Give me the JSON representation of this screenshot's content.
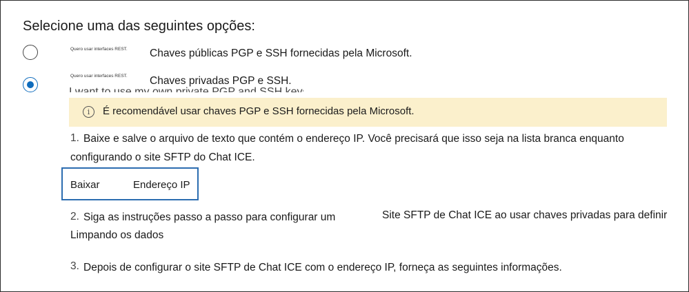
{
  "prompt": "Selecione uma das seguintes opções:",
  "options": [
    {
      "small_text": "Quero usar interfaces REST.",
      "label": "Chaves públicas PGP e SSH fornecidas pela Microsoft.",
      "selected": false
    },
    {
      "small_text": "Quero usar interfaces REST.",
      "label": "Chaves privadas PGP e SSH.",
      "selected": true
    }
  ],
  "ghost_text": "I want to use my own private PGP and SSH keys",
  "notice": {
    "icon": "info-icon",
    "icon_glyph": "i",
    "text": "É recomendável usar chaves PGP e SSH fornecidas pela Microsoft.",
    "background": "#fbf0cc"
  },
  "steps": [
    {
      "number": "1.",
      "line1": "Baixe e salve o arquivo de texto que contém o endereço IP. Você precisará que isso seja na lista branca enquanto",
      "line2": "configurando o site SFTP do Chat ICE."
    },
    {
      "number": "2.",
      "line1": "Siga as instruções passo a passo para configurar um",
      "line1_right": "Site SFTP de Chat ICE ao usar chaves privadas para definir",
      "line2": "Limpando os dados"
    },
    {
      "number": "3.",
      "line1": "Depois de configurar o site SFTP de Chat ICE com o endereço IP, forneça as seguintes informações."
    }
  ],
  "download": {
    "label1": "Baixar",
    "label2": "Endereço IP"
  },
  "colors": {
    "accent": "#0f6cbd",
    "button_border": "#2b6cb0"
  }
}
